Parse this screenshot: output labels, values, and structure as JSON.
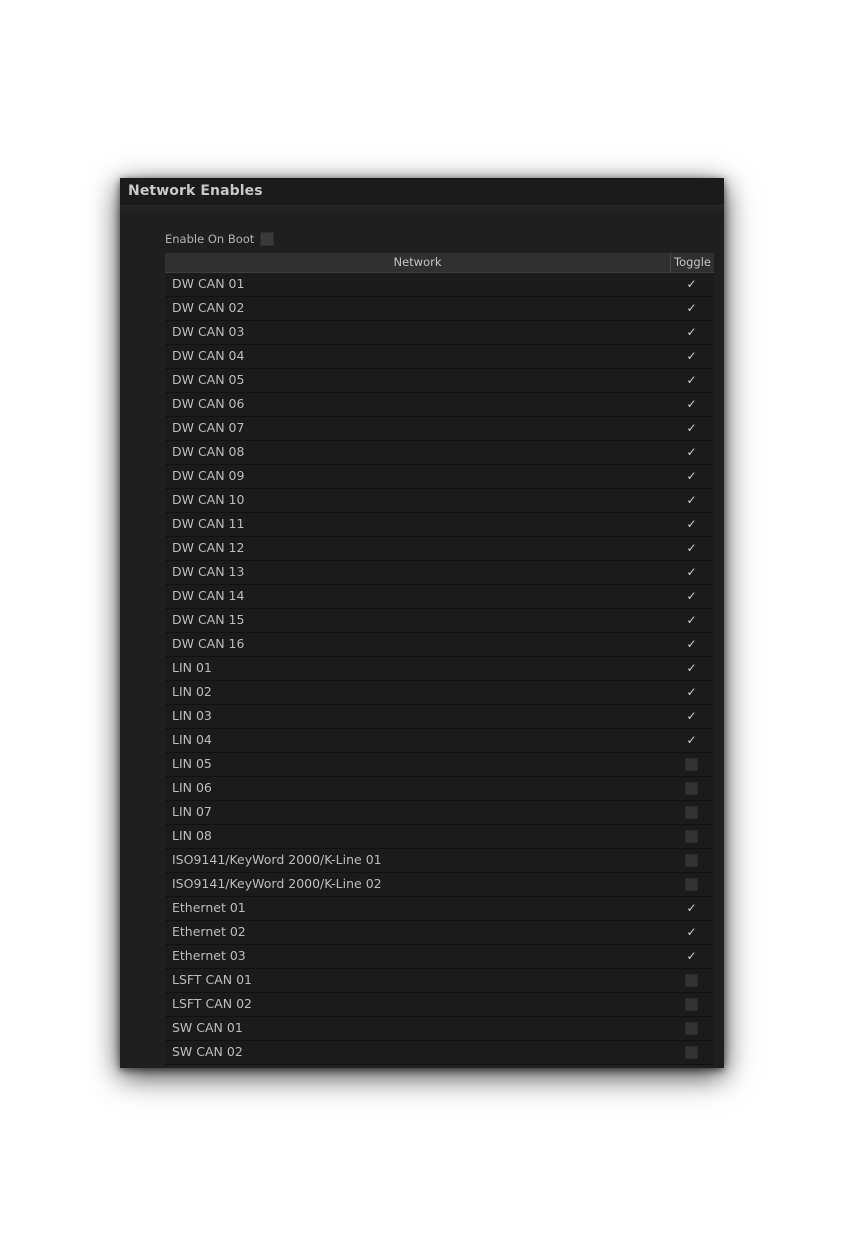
{
  "window": {
    "title": "Network Enables"
  },
  "boot": {
    "label": "Enable On Boot",
    "checked": false
  },
  "table": {
    "headers": {
      "network": "Network",
      "toggle": "Toggle"
    },
    "check_glyph": "✓",
    "rows": [
      {
        "name": "DW CAN 01",
        "enabled": true
      },
      {
        "name": "DW CAN 02",
        "enabled": true
      },
      {
        "name": "DW CAN 03",
        "enabled": true
      },
      {
        "name": "DW CAN 04",
        "enabled": true
      },
      {
        "name": "DW CAN 05",
        "enabled": true
      },
      {
        "name": "DW CAN 06",
        "enabled": true
      },
      {
        "name": "DW CAN 07",
        "enabled": true
      },
      {
        "name": "DW CAN 08",
        "enabled": true
      },
      {
        "name": "DW CAN 09",
        "enabled": true
      },
      {
        "name": "DW CAN 10",
        "enabled": true
      },
      {
        "name": "DW CAN 11",
        "enabled": true
      },
      {
        "name": "DW CAN 12",
        "enabled": true
      },
      {
        "name": "DW CAN 13",
        "enabled": true
      },
      {
        "name": "DW CAN 14",
        "enabled": true
      },
      {
        "name": "DW CAN 15",
        "enabled": true
      },
      {
        "name": "DW CAN 16",
        "enabled": true
      },
      {
        "name": "LIN 01",
        "enabled": true
      },
      {
        "name": "LIN 02",
        "enabled": true
      },
      {
        "name": "LIN 03",
        "enabled": true
      },
      {
        "name": "LIN 04",
        "enabled": true
      },
      {
        "name": "LIN 05",
        "enabled": false
      },
      {
        "name": "LIN 06",
        "enabled": false
      },
      {
        "name": "LIN 07",
        "enabled": false
      },
      {
        "name": "LIN 08",
        "enabled": false
      },
      {
        "name": "ISO9141/KeyWord 2000/K-Line 01",
        "enabled": false
      },
      {
        "name": "ISO9141/KeyWord 2000/K-Line 02",
        "enabled": false
      },
      {
        "name": "Ethernet 01",
        "enabled": true
      },
      {
        "name": "Ethernet 02",
        "enabled": true
      },
      {
        "name": "Ethernet 03",
        "enabled": true
      },
      {
        "name": "LSFT CAN 01",
        "enabled": false
      },
      {
        "name": "LSFT CAN 02",
        "enabled": false
      },
      {
        "name": "SW CAN 01",
        "enabled": false
      },
      {
        "name": "SW CAN 02",
        "enabled": false
      }
    ]
  }
}
